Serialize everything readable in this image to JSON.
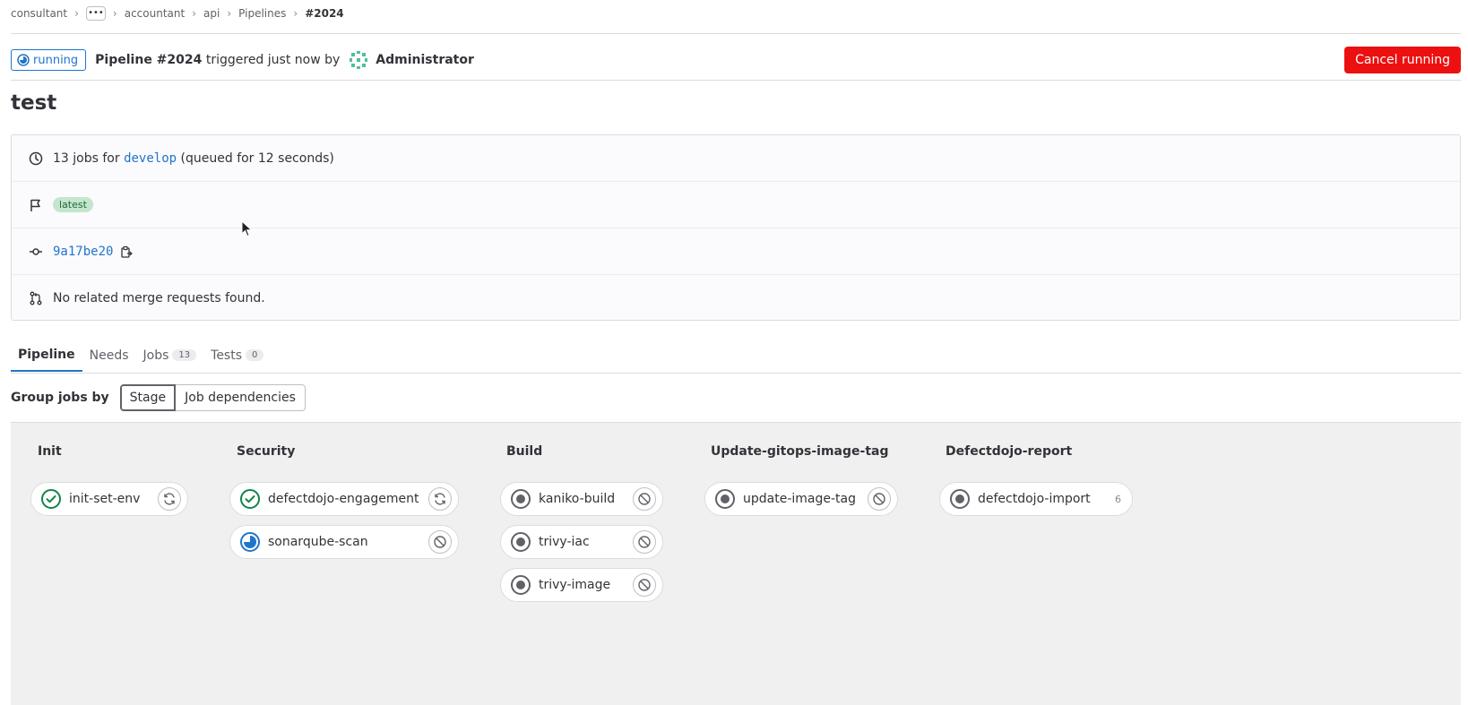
{
  "breadcrumb": {
    "items": [
      "consultant",
      "accountant",
      "api",
      "Pipelines"
    ],
    "ellipsis": "•••",
    "current": "#2024"
  },
  "header": {
    "status": "running",
    "pipeline": "Pipeline #2024",
    "triggered": "triggered just now by",
    "user": "Administrator",
    "cancel_label": "Cancel running"
  },
  "title": "test",
  "info": {
    "jobs_prefix": "13 jobs for",
    "branch": "develop",
    "queued": "(queued for 12 seconds)",
    "tag": "latest",
    "commit": "9a17be20",
    "merge_requests": "No related merge requests found."
  },
  "tabs": [
    {
      "label": "Pipeline"
    },
    {
      "label": "Needs"
    },
    {
      "label": "Jobs",
      "count": "13"
    },
    {
      "label": "Tests",
      "count": "0"
    }
  ],
  "groupby": {
    "label": "Group jobs by",
    "options": [
      "Stage",
      "Job dependencies"
    ],
    "selected": "Stage"
  },
  "stages": [
    {
      "name": "Init",
      "jobs": [
        {
          "name": "init-set-env",
          "status": "success",
          "action": "retry-icon"
        }
      ]
    },
    {
      "name": "Security",
      "jobs": [
        {
          "name": "defectdojo-engagement",
          "status": "success",
          "action": "retry-icon"
        },
        {
          "name": "sonarqube-scan",
          "status": "running",
          "action": "cancel-icon"
        }
      ]
    },
    {
      "name": "Build",
      "jobs": [
        {
          "name": "kaniko-build",
          "status": "created",
          "action": "cancel-icon"
        },
        {
          "name": "trivy-iac",
          "status": "created",
          "action": "cancel-icon"
        },
        {
          "name": "trivy-image",
          "status": "created",
          "action": "cancel-icon"
        }
      ]
    },
    {
      "name": "Update-gitops-image-tag",
      "jobs": [
        {
          "name": "update-image-tag",
          "status": "created",
          "action": "cancel-icon"
        }
      ]
    },
    {
      "name": "Defectdojo-report",
      "jobs": [
        {
          "name": "defectdojo-import",
          "status": "created",
          "count": "6"
        }
      ]
    }
  ],
  "colors": {
    "accent": "#1f75cb",
    "success": "#108548",
    "danger": "#ec1010",
    "tag_bg": "#c3e6cd"
  }
}
